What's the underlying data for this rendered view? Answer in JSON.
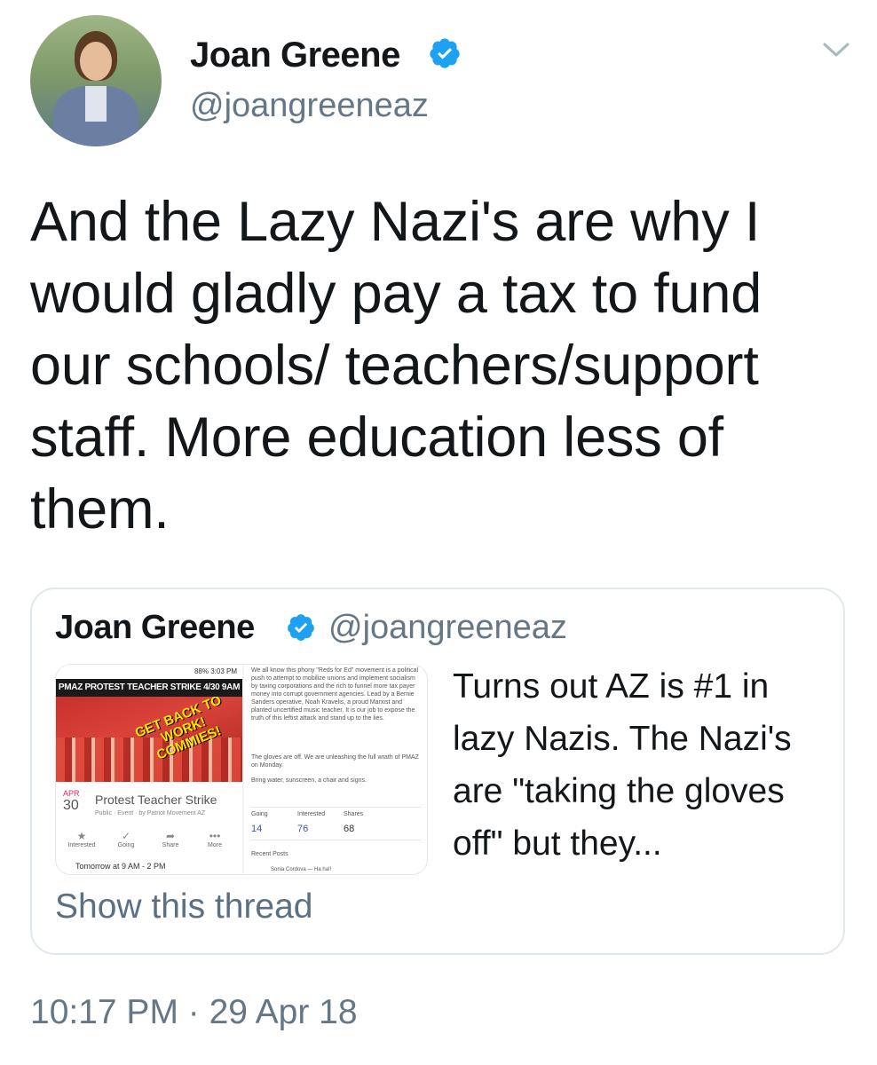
{
  "author": {
    "display_name": "Joan Greene",
    "handle": "@joangreeneaz",
    "verified": true
  },
  "menu_icon": "chevron-down-icon",
  "tweet": {
    "text": "And the Lazy Nazi's are why I would gladly pay a tax to fund our schools/ teachers/support staff. More education less of them.",
    "timestamp": "10:17 PM · 29 Apr 18"
  },
  "quoted_tweet": {
    "display_name": "Joan Greene",
    "handle": "@joangreeneaz",
    "verified": true,
    "text": "Turns out AZ is #1 in lazy Nazis. The Nazi's are \"taking the gloves off\" but they...",
    "show_thread": "Show this thread",
    "media": {
      "status_bar": "88% 3:03 PM",
      "banner": "PMAZ PROTEST TEACHER STRIKE 4/30 9AM",
      "slogan": "GET BACK TO WORK! COMMIES!",
      "event_month": "APR",
      "event_day": "30",
      "event_title": "Protest Teacher Strike",
      "event_sub": "Public · Event · by Patriot Movement AZ",
      "actions": [
        "Interested",
        "Going",
        "Share",
        "More"
      ],
      "event_time": "Tomorrow at 9 AM - 2 PM",
      "description": [
        "We all know this phony \"Reds for Ed\" movement is a political push to attempt to mobilize unions and implement socialism by taxing corporations and the rich to funnel more tax payer money into corrupt government agencies. Lead by a Bernie Sanders operative, Noah Kravelis, a proud Marxist and planted uncertified music teacher. It is our job to expose the truth of this leftist attack and stand up to the lies.",
        "The gloves are off. We are unleashing the full wrath of PMAZ on Monday.",
        "Bring water, sunscreen, a chair and signs."
      ],
      "stats": [
        {
          "label": "Going",
          "value": "14"
        },
        {
          "label": "Interested",
          "value": "76"
        },
        {
          "label": "Shares",
          "value": "68"
        }
      ],
      "recent_posts": "Recent Posts",
      "commenter": "Sonia Cordova — Ha ha!!"
    }
  },
  "colors": {
    "text": "#14171a",
    "secondary": "#657786",
    "verified": "#1da1f2",
    "border": "#e1e8ed"
  }
}
